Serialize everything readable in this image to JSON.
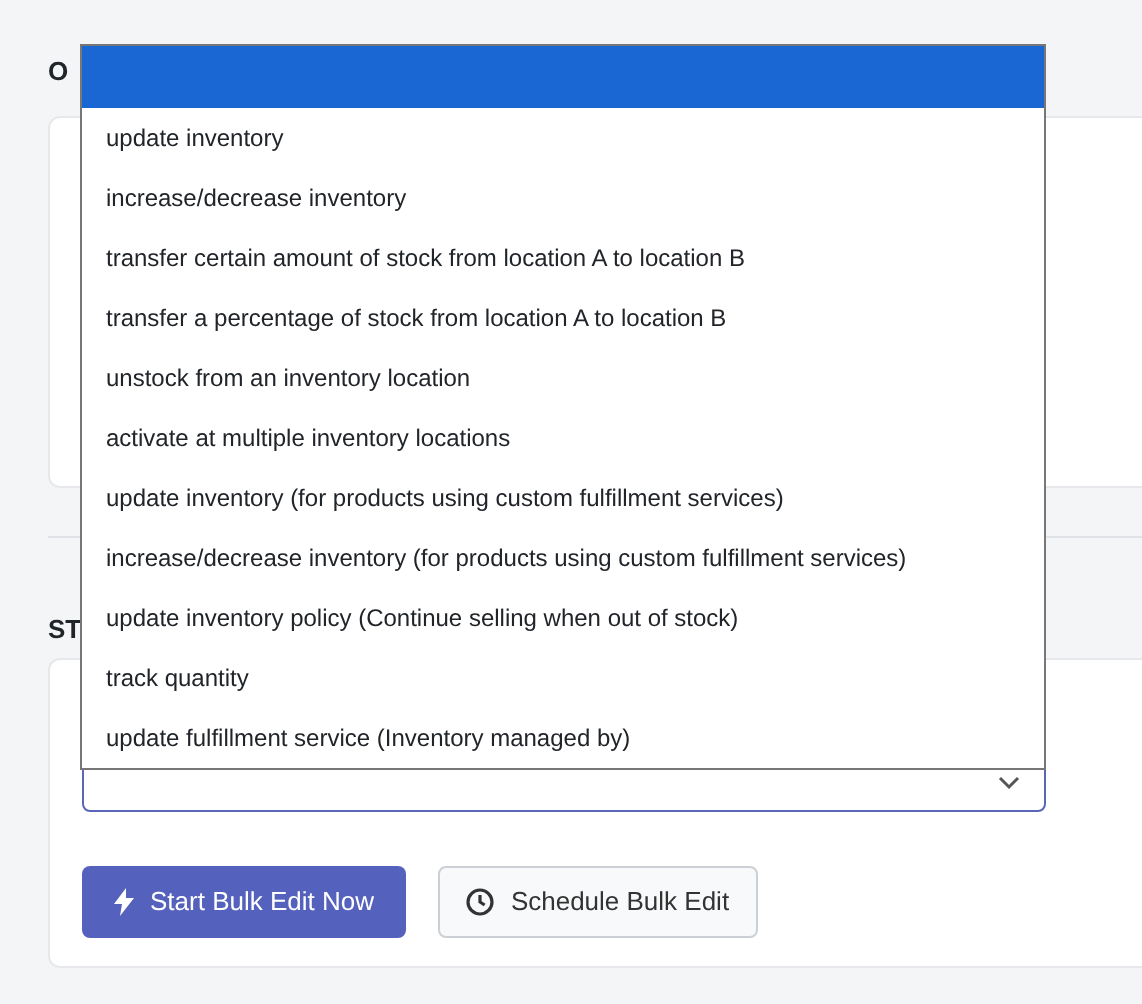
{
  "sections": [
    {
      "heading": "O"
    },
    {
      "heading": "ST"
    }
  ],
  "dropdown": {
    "options": [
      {
        "kind": "blank",
        "selected": true
      },
      {
        "kind": "option",
        "label": "update inventory",
        "selected": false
      },
      {
        "kind": "option",
        "label": "increase/decrease inventory",
        "selected": false
      },
      {
        "kind": "option",
        "label": "transfer certain amount of stock from location A to location B",
        "selected": false
      },
      {
        "kind": "option",
        "label": "transfer a percentage of stock from location A to location B",
        "selected": false
      },
      {
        "kind": "option",
        "label": "unstock from an inventory location",
        "selected": false
      },
      {
        "kind": "option",
        "label": "activate at multiple inventory locations",
        "selected": false
      },
      {
        "kind": "option",
        "label": "update inventory (for products using custom fulfillment services)",
        "selected": false
      },
      {
        "kind": "option",
        "label": "increase/decrease inventory (for products using custom fulfillment services)",
        "selected": false
      },
      {
        "kind": "option",
        "label": "update inventory policy (Continue selling when out of stock)",
        "selected": false
      },
      {
        "kind": "option",
        "label": "track quantity",
        "selected": false
      },
      {
        "kind": "option",
        "label": "update fulfillment service (Inventory managed by)",
        "selected": false
      }
    ]
  },
  "buttons": [
    {
      "kind": "primary",
      "label": "Start Bulk Edit Now"
    },
    {
      "kind": "secondary",
      "label": "Schedule Bulk Edit"
    }
  ]
}
